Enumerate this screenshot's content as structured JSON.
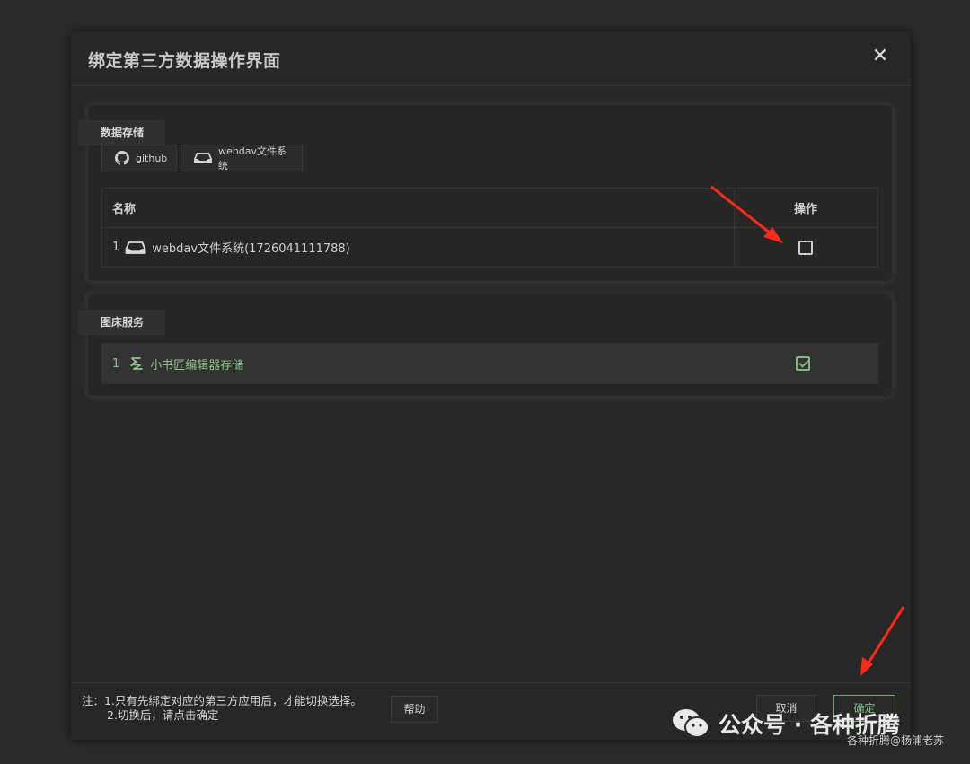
{
  "dialog": {
    "title": "绑定第三方数据操作界面",
    "close_glyph": "✕"
  },
  "data_storage": {
    "label": "数据存储",
    "sources": [
      {
        "label": "github",
        "icon": "github-icon"
      },
      {
        "label": "webdav文件系统",
        "icon": "cloud-drive-icon"
      }
    ],
    "table": {
      "headers": {
        "name": "名称",
        "action": "操作"
      },
      "rows": [
        {
          "index": "1",
          "icon": "cloud-drive-icon",
          "name": "webdav文件系统(1726041111788)",
          "checked": false
        }
      ]
    }
  },
  "image_hosting": {
    "label": "图床服务",
    "rows": [
      {
        "index": "1",
        "icon": "xiaoshujiang-logo",
        "name": "小书匠编辑器存储",
        "checked": true
      }
    ]
  },
  "footer": {
    "note_line1": "注：1.只有先绑定对应的第三方应用后，才能切换选择。",
    "note_line2": "2.切换后，请点击确定",
    "help": "帮助",
    "cancel": "取消",
    "confirm": "确定"
  },
  "overlay": {
    "watermark": "公众号 · 各种折腾",
    "credit": "各种折腾@杨浦老苏",
    "arrow_color": "#ff2a1a"
  },
  "colors": {
    "background": "#2b2b2b",
    "dialog": "#272727",
    "accent_green": "#7dbb7d"
  }
}
